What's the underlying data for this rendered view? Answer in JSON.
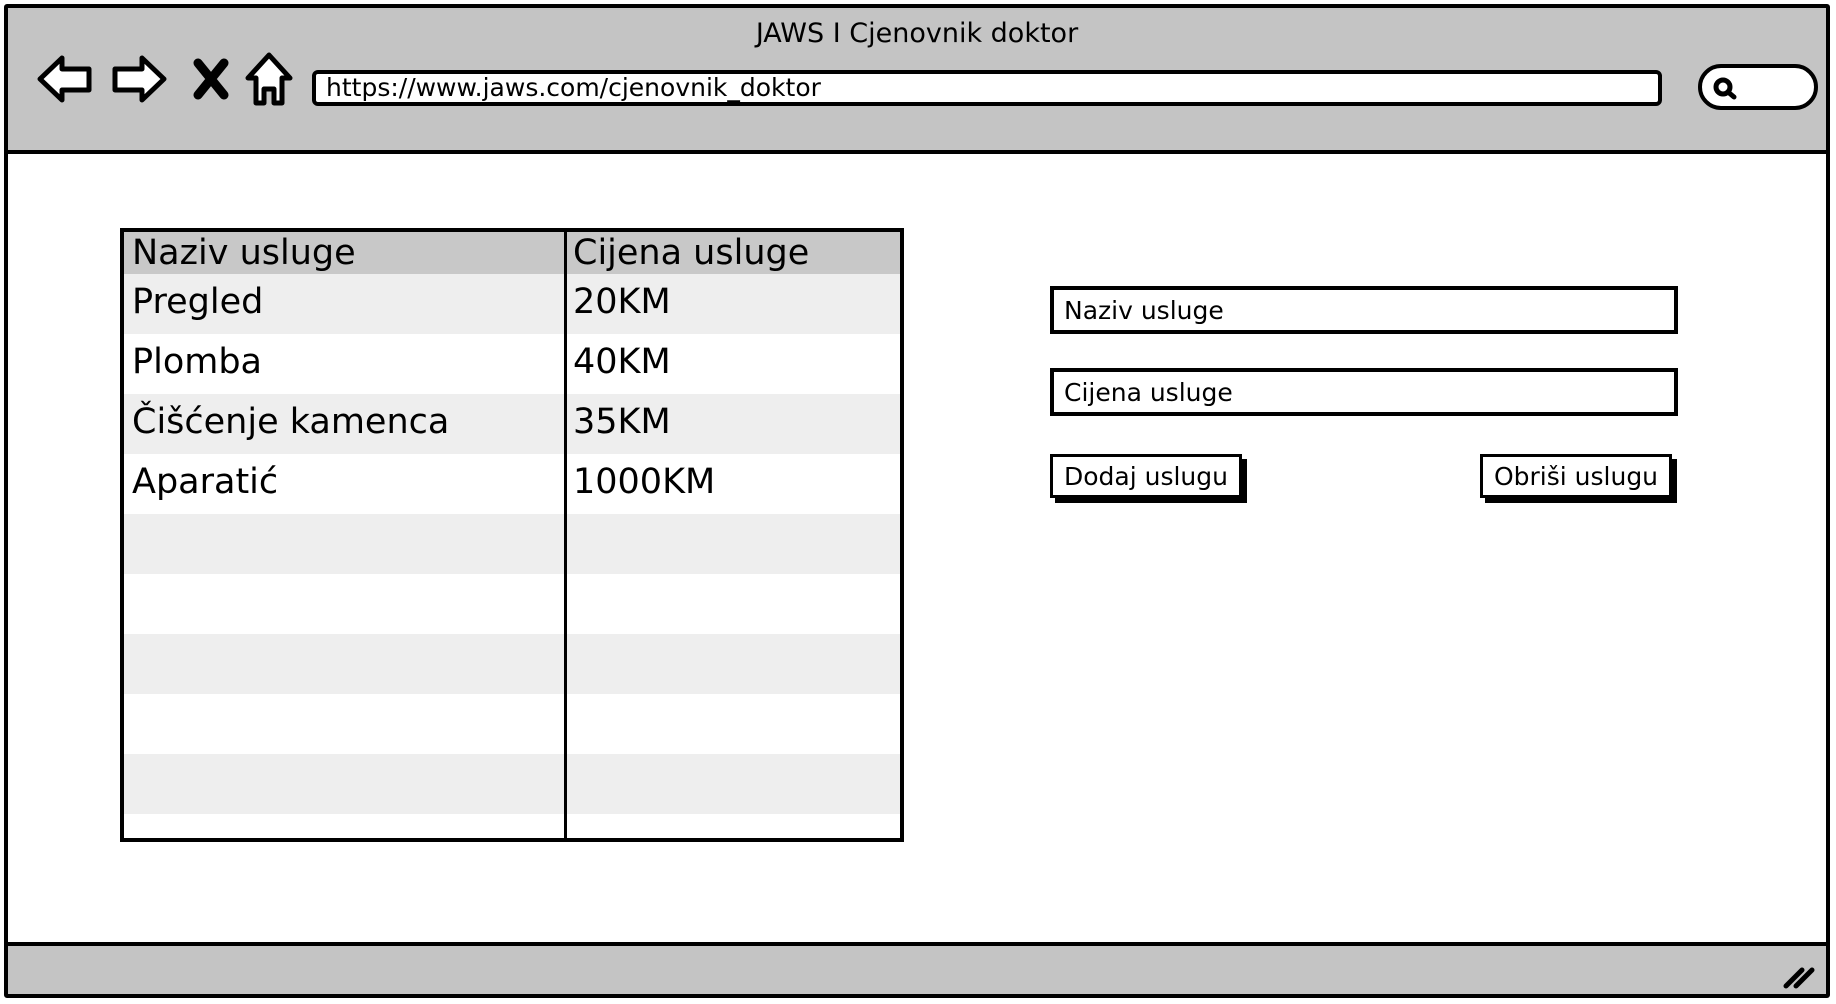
{
  "window": {
    "title": "JAWS I Cjenovnik doktor",
    "url": "https://www.jaws.com/cjenovnik_doktor"
  },
  "nav": {
    "back_icon": "back-arrow-icon",
    "forward_icon": "forward-arrow-icon",
    "stop_icon": "close-icon",
    "home_icon": "home-icon",
    "search_icon": "search-icon"
  },
  "table": {
    "headers": [
      "Naziv usluge",
      "Cijena usluge"
    ],
    "rows": [
      {
        "name": "Pregled",
        "price": "20KM"
      },
      {
        "name": "Plomba",
        "price": "40KM"
      },
      {
        "name": "Čišćenje kamenca",
        "price": "35KM"
      },
      {
        "name": "Aparatić",
        "price": "1000KM"
      }
    ],
    "empty_rows": 6
  },
  "form": {
    "name_field": "Naziv usluge",
    "price_field": "Cijena usluge",
    "add_button": "Dodaj uslugu",
    "delete_button": "Obriši uslugu"
  },
  "colors": {
    "chrome": "#c4c4c4",
    "header_row": "#c8c8c8",
    "alt_row": "#eeeeee"
  }
}
